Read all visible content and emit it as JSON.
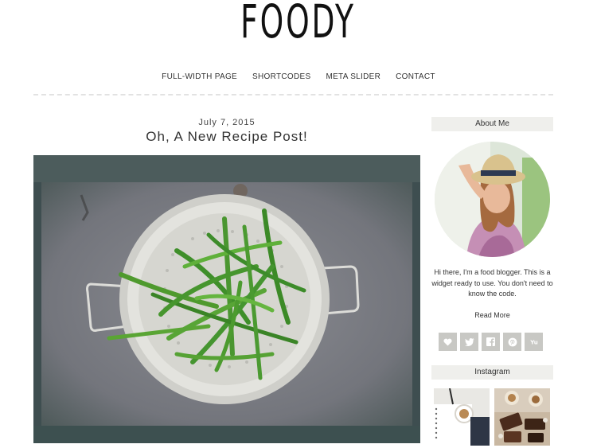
{
  "site": {
    "logo": "FOODY"
  },
  "nav": {
    "items": [
      "FULL-WIDTH PAGE",
      "SHORTCODES",
      "META SLIDER",
      "CONTACT"
    ]
  },
  "post": {
    "date": "July 7, 2015",
    "title": "Oh, A New Recipe Post!"
  },
  "sidebar": {
    "about_heading": "About Me",
    "bio": "Hi there, I'm a food blogger. This is a widget ready to use. You don't need to know the code.",
    "read_more": "Read More",
    "social_icons": [
      "heart-icon",
      "twitter-icon",
      "facebook-icon",
      "pinterest-icon",
      "yummly-icon"
    ],
    "instagram_heading": "Instagram"
  },
  "colors": {
    "widget_bg": "#efefec",
    "social_bg": "#c8c8c4",
    "green": "#3f8f2a"
  }
}
